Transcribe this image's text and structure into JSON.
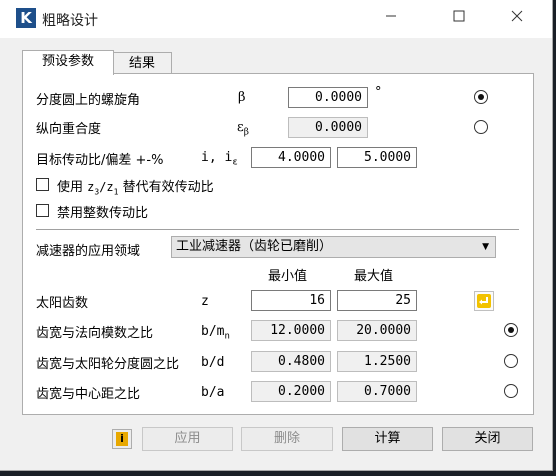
{
  "window": {
    "title": "粗略设计",
    "icon_letter": "K",
    "minimize": "—",
    "maximize": "☐",
    "close": "✕"
  },
  "tabs": [
    {
      "label": "预设参数",
      "active": true
    },
    {
      "label": "结果",
      "active": false
    }
  ],
  "helix": {
    "label": "分度圆上的螺旋角",
    "symbol": "β",
    "value": "0.0000",
    "unit": "°",
    "selected": true
  },
  "overlap": {
    "label": "纵向重合度",
    "symbol": "εβ",
    "value": "0.0000",
    "selected": false
  },
  "ratio": {
    "label": "目标传动比/偏差 +-%",
    "symbol": "i, iε",
    "min": "4.0000",
    "max": "5.0000"
  },
  "options": {
    "use_z3_z1": "使用 z3/z1 替代有效传动比",
    "use_integer": "禁用整数传动比",
    "use_z3_z1_checked": false,
    "use_integer_checked": false
  },
  "application": {
    "label": "减速器的应用领域",
    "selected": "工业减速器（齿轮已磨削）"
  },
  "headers": {
    "min": "最小值",
    "max": "最大值"
  },
  "sun_teeth": {
    "label": "太阳齿数",
    "symbol": "z",
    "min": "16",
    "max": "25"
  },
  "width_module": {
    "label": "齿宽与法向模数之比",
    "symbol": "b/mn",
    "min": "12.0000",
    "max": "20.0000",
    "selected": true
  },
  "width_sun": {
    "label": "齿宽与太阳轮分度圆之比",
    "symbol": "b/d",
    "min": "0.4800",
    "max": "1.2500",
    "selected": false
  },
  "width_center": {
    "label": "齿宽与中心距之比",
    "symbol": "b/a",
    "min": "0.2000",
    "max": "0.7000",
    "selected": false
  },
  "buttons": {
    "apply": "应用",
    "delete": "删除",
    "calculate": "计算",
    "close": "关闭",
    "info_icon": "info-icon"
  },
  "colors": {
    "background": "#1a1f26",
    "window": "#f0f0f0",
    "panel": "#ffffff",
    "icon_blue": "#1e4f8a",
    "info_yellow": "#e8a800"
  }
}
